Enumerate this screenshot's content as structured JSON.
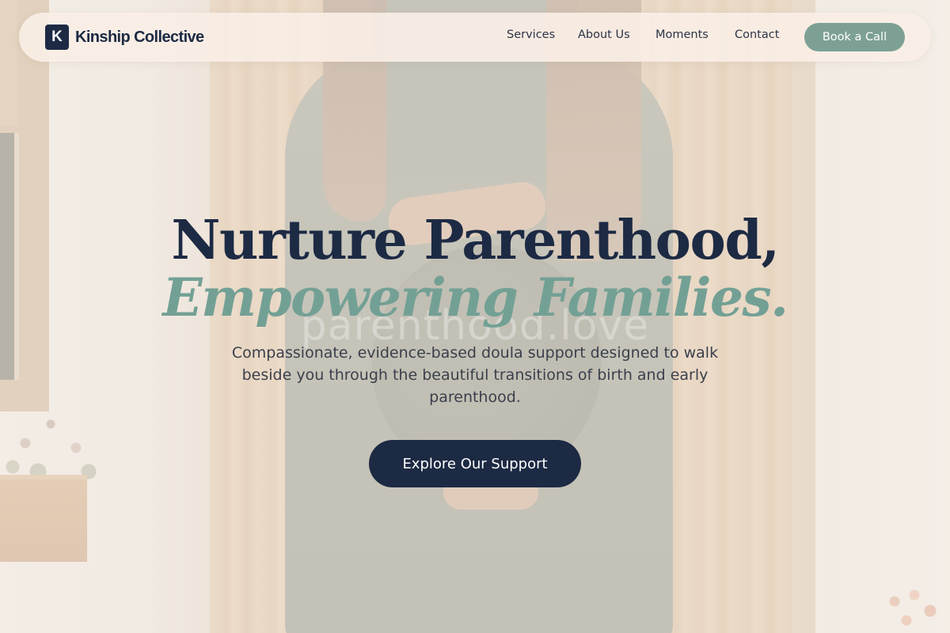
{
  "brand": {
    "mark": "K",
    "name": "Kinship Collective"
  },
  "nav": {
    "items": [
      {
        "label": "Services"
      },
      {
        "label": "About Us"
      },
      {
        "label": "Moments"
      },
      {
        "label": "Contact"
      }
    ],
    "cta_label": "Book a Call"
  },
  "hero": {
    "title_line1": "Nurture Parenthood,",
    "title_line2": "Empowering Families.",
    "subtitle": "Compassionate, evidence-based doula support designed to walk beside you through the beautiful transitions of birth and early parenthood.",
    "cta_label": "Explore Our Support",
    "watermark": "parenthood.love"
  },
  "colors": {
    "navy": "#1d2a44",
    "sage": "#73a095",
    "nav_button": "#7da095",
    "nav_background": "#f8eee5"
  },
  "icons": {
    "brand_logo": "letter-k-logo-icon"
  }
}
